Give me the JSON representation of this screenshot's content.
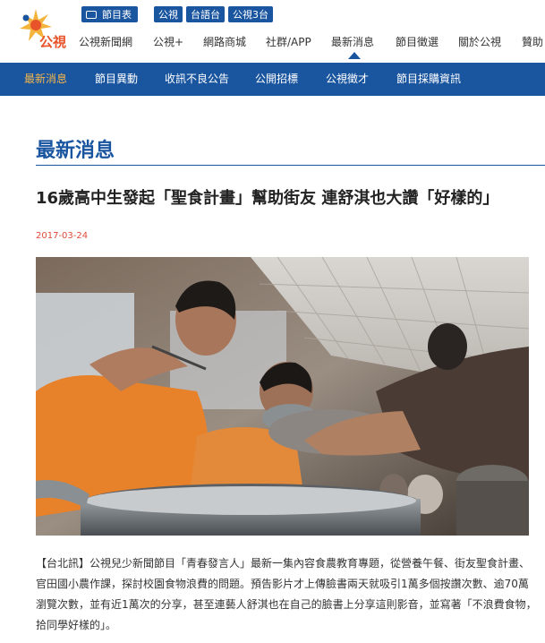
{
  "header": {
    "logo_text": "公視",
    "tv_guide_label": "節目表",
    "channels": [
      "公視",
      "台語台",
      "公視3台"
    ],
    "nav_items": [
      "公視新聞網",
      "公視+",
      "網路商城",
      "社群/APP",
      "最新消息",
      "節目徵選",
      "關於公視",
      "贊助"
    ]
  },
  "subnav": {
    "items": [
      "最新消息",
      "節目異動",
      "收訊不良公告",
      "公開招標",
      "公視徵才",
      "節目採購資訊"
    ]
  },
  "page": {
    "section_title": "最新消息",
    "headline": "16歲高中生發起「聖食計畫」幫助街友 連舒淇也大讚「好樣的」",
    "date": "2017-03-24",
    "body": "【台北訊】公視兒少新聞節目「青春發言人」最新一集內容食農教育專題，從營養午餐、街友聖食計畫、官田國小農作課，探討校園食物浪費的問題。預告影片才上傳臉書兩天就吸引1萬多個按讚次數、逾70萬瀏覽次數，並有近1萬次的分享，甚至連藝人舒淇也在自己的臉書上分享這則影音，並寫著「不浪費食物，拾同學好樣的」。"
  },
  "colors": {
    "brand_blue": "#1a55a0",
    "active_orange": "#f3b64a",
    "date_red": "#e04a3a",
    "logo_orange": "#e8532a"
  }
}
